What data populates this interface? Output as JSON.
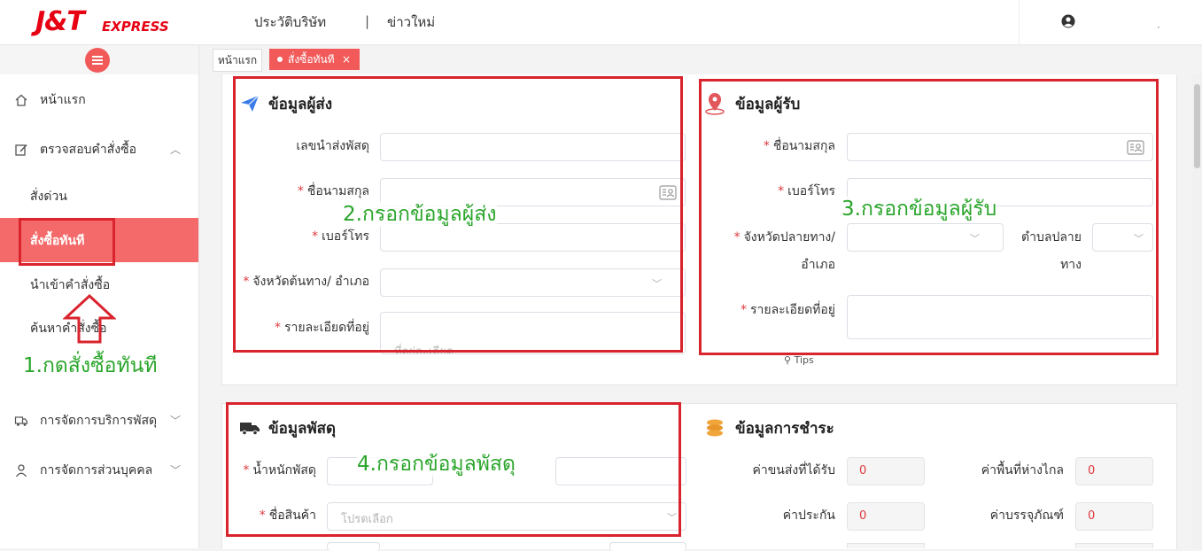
{
  "brand": {
    "logo_main": "J&T",
    "logo_sub": "EXPRESS",
    "color": "#e60012"
  },
  "header": {
    "nav": [
      "ประวัติบริษัท",
      "|",
      "ข่าวใหม่"
    ],
    "user_dot": "·"
  },
  "sidebar": {
    "home": "หน้าแรก",
    "check_orders": "ตรวจสอบคำสั่งซื้อ",
    "sub_items": [
      "สั่งด่วน",
      "สั่งซื้อทันที",
      "นำเข้าคำสั่งซื้อ",
      "ค้นหาคำสั่งซื้อ"
    ],
    "parcel_mgmt": "การจัดการบริการพัสดุ",
    "personal_mgmt": "การจัดการส่วนบุคคล"
  },
  "tabs": {
    "home": "หน้าแรก",
    "active": "สั่งซื้อทันที",
    "close": "×"
  },
  "sender": {
    "title": "ข้อมูลผู้ส่ง",
    "tracking_label": "เลขนำส่งพัสดุ",
    "name_label": "ชื่อนามสกุล",
    "phone_label": "เบอร์โทร",
    "province_label": "จังหวัดต้นทาง/ อำเภอ",
    "address_label": "รายละเอียดที่อยู่",
    "address_hint": "ที่อยู่ละเอียด"
  },
  "receiver": {
    "title": "ข้อมูลผู้รับ",
    "name_label": "ชื่อนามสกุล",
    "phone_label": "เบอร์โทร",
    "province_label": "จังหวัดปลายทาง/",
    "province_label2": "อำเภอ",
    "subdistrict_label": "ตำบลปลาย",
    "subdistrict_label2": "ทาง",
    "address_label": "รายละเอียดที่อยู่",
    "tips": "Tips"
  },
  "parcel": {
    "title": "ข้อมูลพัสดุ",
    "weight_label": "น้ำหนักพัสดุ",
    "product_label": "ชื่อสินค้า",
    "product_placeholder": "โปรดเลือก"
  },
  "payment": {
    "title": "ข้อมูลการชำระ",
    "shipping_label": "ค่าขนส่งที่ได้รับ",
    "shipping_value": "0",
    "remote_label": "ค่าพื้นที่ห่างไกล",
    "remote_value": "0",
    "insurance_label": "ค่าประกัน",
    "insurance_value": "0",
    "packaging_label": "ค่าบรรจุภัณฑ์",
    "packaging_value": "0"
  },
  "annotations": {
    "step1": "1.กดสั่งซื้อทันที",
    "step2": "2.กรอกข้อมูลผู้ส่ง",
    "step3": "3.กรอกข้อมูลผู้รับ",
    "step4": "4.กรอกข้อมูลพัสดุ",
    "box_color": "#d9232d",
    "text_color": "#2aa52a"
  },
  "colors": {
    "accent": "#f25a5a",
    "active_bg": "#f46a6a",
    "required": "#e0393e"
  }
}
